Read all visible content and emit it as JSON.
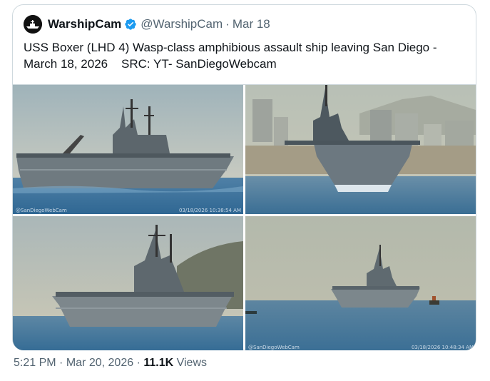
{
  "quoted": {
    "name": "WarshipCam",
    "handle": "@WarshipCam",
    "separator": "·",
    "date": "Mar 18",
    "text": "USS Boxer (LHD 4) Wasp-class amphibious assault ship leaving San Diego -\nMarch 18, 2026    SRC: YT- SanDiegoWebcam",
    "avatar_icon": "warship-silhouette-icon",
    "verified_icon": "verified-badge-icon",
    "verified_color": "#1d9bf0"
  },
  "photos": {
    "p1": {
      "wm_left": "@SanDiegoWebCam",
      "wm_right": "03/18/2026 10:38:54 AM"
    },
    "p2": {},
    "p3": {},
    "p4": {
      "wm_left": "@SanDiegoWebCam",
      "wm_right": "03/18/2026 10:48:34 AM"
    }
  },
  "meta": {
    "time": "5:21 PM",
    "sep1": "·",
    "date": "Mar 20, 2026",
    "sep2": "·",
    "views_count": "11.1K",
    "views_label": "Views"
  }
}
